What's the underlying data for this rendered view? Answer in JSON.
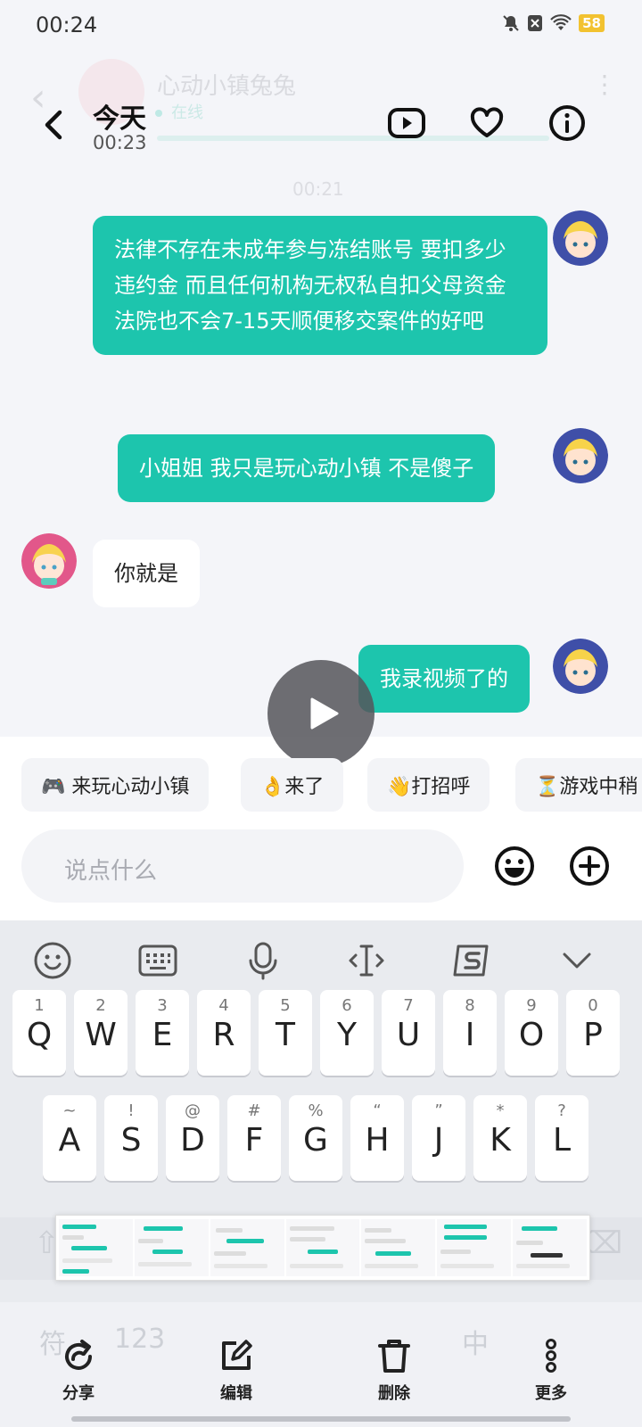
{
  "status_bar": {
    "time": "00:24",
    "battery": "58"
  },
  "background_chat": {
    "contact_name": "心动小镇兔兔",
    "status": "在线",
    "timestamp": "00:21"
  },
  "header": {
    "title": "今天",
    "subtitle": "00:23"
  },
  "messages": [
    {
      "side": "out",
      "text": "法律不存在未成年参与冻结账号 要扣多少违约金 而且任何机构无权私自扣父母资金 法院也不会7-15天顺便移交案件的好吧"
    },
    {
      "side": "out",
      "text": "小姐姐 我只是玩心动小镇 不是傻子"
    },
    {
      "side": "in",
      "text": "你就是"
    },
    {
      "side": "out",
      "text": "我录视频了的"
    }
  ],
  "quick_replies": [
    "🎮 来玩心动小镇",
    "👌来了",
    "👋打招呼",
    "⏳游戏中稍"
  ],
  "input": {
    "placeholder": "说点什么"
  },
  "keyboard": {
    "row1": [
      {
        "num": "1",
        "letter": "Q"
      },
      {
        "num": "2",
        "letter": "W"
      },
      {
        "num": "3",
        "letter": "E"
      },
      {
        "num": "4",
        "letter": "R"
      },
      {
        "num": "5",
        "letter": "T"
      },
      {
        "num": "6",
        "letter": "Y"
      },
      {
        "num": "7",
        "letter": "U"
      },
      {
        "num": "8",
        "letter": "I"
      },
      {
        "num": "9",
        "letter": "O"
      },
      {
        "num": "0",
        "letter": "P"
      }
    ],
    "row2": [
      {
        "num": "~",
        "letter": "A"
      },
      {
        "num": "!",
        "letter": "S"
      },
      {
        "num": "@",
        "letter": "D"
      },
      {
        "num": "#",
        "letter": "F"
      },
      {
        "num": "%",
        "letter": "G"
      },
      {
        "num": "“",
        "letter": "H"
      },
      {
        "num": "”",
        "letter": "J"
      },
      {
        "num": "*",
        "letter": "K"
      },
      {
        "num": "?",
        "letter": "L"
      }
    ],
    "bottom_row": {
      "symbols": "符",
      "numbers": "123",
      "lang": "中"
    }
  },
  "actions": {
    "share": "分享",
    "edit": "编辑",
    "delete": "删除",
    "more": "更多"
  },
  "colors": {
    "accent": "#1dc5ad",
    "background": "#f4f5f9"
  }
}
